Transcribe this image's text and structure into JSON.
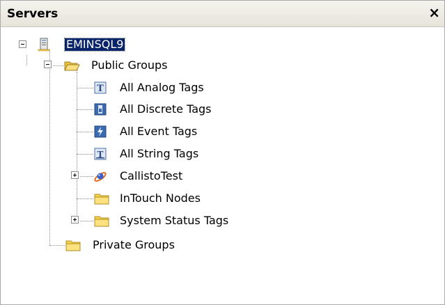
{
  "panel": {
    "title": "Servers",
    "close_glyph": "×"
  },
  "tree": {
    "root": {
      "label": "EMINSQL9",
      "icon": "server-icon",
      "selected": true,
      "expanded": true
    },
    "public_groups": {
      "label": "Public Groups",
      "icon": "open-folder-icon",
      "expanded": true
    },
    "items": [
      {
        "label": "All Analog Tags",
        "icon": "analog-tag-icon"
      },
      {
        "label": "All Discrete Tags",
        "icon": "discrete-tag-icon"
      },
      {
        "label": "All Event Tags",
        "icon": "event-tag-icon"
      },
      {
        "label": "All String Tags",
        "icon": "string-tag-icon"
      },
      {
        "label": "CallistoTest",
        "icon": "satellite-icon",
        "collapsed": true
      },
      {
        "label": "InTouch Nodes",
        "icon": "folder-icon"
      },
      {
        "label": "System Status Tags",
        "icon": "folder-icon",
        "collapsed": true
      }
    ],
    "private_groups": {
      "label": "Private Groups",
      "icon": "folder-icon"
    }
  },
  "colors": {
    "selection": "#0a246a",
    "folder": "#f7d34a",
    "tag_icon": "#3c6ab0"
  }
}
